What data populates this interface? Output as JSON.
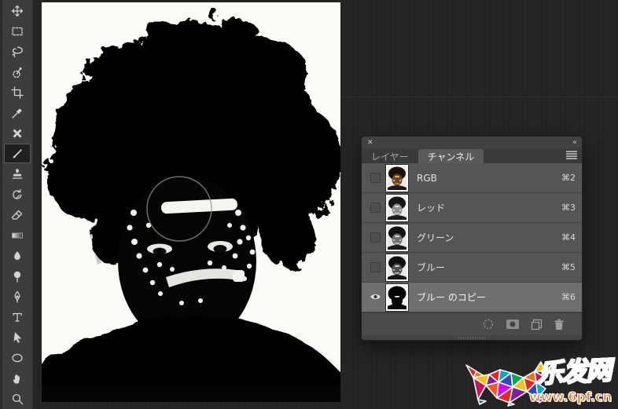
{
  "toolbar": {
    "tools": [
      "move",
      "rectangular-marquee",
      "lasso",
      "quick-selection",
      "crop",
      "eyedropper",
      "spot-healing-brush",
      "brush",
      "clone-stamp",
      "history-brush",
      "eraser",
      "gradient",
      "blur",
      "dodge",
      "pen",
      "type",
      "path-selection",
      "ellipse-shape",
      "hand",
      "zoom"
    ],
    "selected_tool": "brush"
  },
  "panel": {
    "close_icon": "✕",
    "collapse_icon": "«",
    "tabs": {
      "layers": "レイヤー",
      "channels": "チャンネル"
    },
    "menu_icon": "hamburger",
    "channels": [
      {
        "name": "RGB",
        "shortcut": "⌘2",
        "visible": false,
        "selected": false,
        "thumb": "color"
      },
      {
        "name": "レッド",
        "shortcut": "⌘3",
        "visible": false,
        "selected": false,
        "thumb": "grayscale"
      },
      {
        "name": "グリーン",
        "shortcut": "⌘4",
        "visible": false,
        "selected": false,
        "thumb": "grayscale"
      },
      {
        "name": "ブルー",
        "shortcut": "⌘5",
        "visible": false,
        "selected": false,
        "thumb": "grayscale"
      },
      {
        "name": "ブルー のコピー",
        "shortcut": "⌘6",
        "visible": true,
        "selected": true,
        "thumb": "black-white"
      }
    ],
    "footer_icons": [
      "load-channel-as-selection",
      "save-selection-as-channel",
      "create-new-channel",
      "delete-channel"
    ]
  },
  "watermark": {
    "site_name": "乐发网",
    "site_url": "www.6pf.cn",
    "accent_red": "#e8251f",
    "accent_orange": "#f4701b"
  },
  "colors": {
    "app_background": "#262626",
    "toolbar_background": "#3d3d3d",
    "panel_row_background": "#555555",
    "panel_selected_row": "#6f6f6f",
    "canvas_background": "#fbfbf8"
  }
}
